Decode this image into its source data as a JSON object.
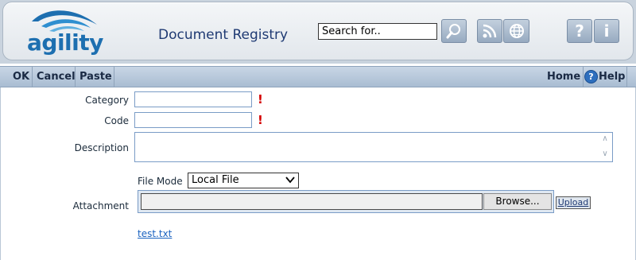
{
  "header": {
    "logo_text": "agility",
    "title": "Document Registry",
    "search_value": "Search for..",
    "buttons": {
      "search_icon": "magnifier-icon",
      "rss_icon": "rss-icon",
      "globe_icon": "globe-icon",
      "help_glyph": "?",
      "info_glyph": "i"
    }
  },
  "toolbar": {
    "ok": "OK",
    "cancel": "Cancel",
    "paste": "Paste",
    "home": "Home",
    "help": "Help",
    "help_icon": "?"
  },
  "form": {
    "category_label": "Category",
    "category_value": "",
    "code_label": "Code",
    "code_value": "",
    "required_marker": "!",
    "description_label": "Description",
    "description_value": "",
    "file_mode_label": "File Mode",
    "file_mode_value": "Local File",
    "attachment_label": "Attachment",
    "browse_label": "Browse...",
    "upload_label": "Upload",
    "attached_file": "test.txt"
  },
  "colors": {
    "brand_blue": "#1d6fb0",
    "title_blue": "#1f3a73",
    "required_red": "#d40000",
    "link_blue": "#1a62c0"
  }
}
